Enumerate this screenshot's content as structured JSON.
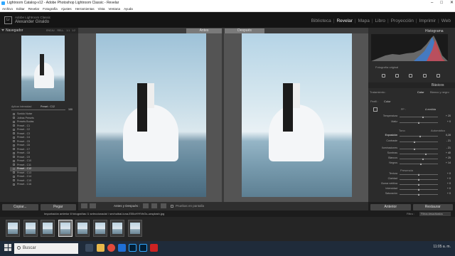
{
  "window": {
    "title": "Lightroom Catalog-v12 - Adobe Photoshop Lightroom Classic - Revelar",
    "controls": [
      "–",
      "□",
      "✕"
    ]
  },
  "menu": [
    "Archivo",
    "Editar",
    "Revelar",
    "Fotografía",
    "Ajustes",
    "Herramientas",
    "Vista",
    "Ventana",
    "Ayuda"
  ],
  "identity": {
    "logo": "Lr",
    "line1": "Adobe Lightroom Classic",
    "line2": "Alexander Giraldo"
  },
  "modules": {
    "items": [
      "Biblioteca",
      "Revelar",
      "Mapa",
      "Libro",
      "Proyección",
      "Imprimir",
      "Web"
    ],
    "active": "Revelar"
  },
  "left_panel": {
    "navigator_title": "Navegador",
    "nav_options": [
      "ENCAJ.",
      "RELL.",
      "1:1",
      "1:2"
    ],
    "amount_label": "Aplicar intensidad",
    "amount_value": "Preset : C12",
    "amount_number": "100",
    "rows": [
      {
        "label": "Sonido Noise",
        "type": "item"
      },
      {
        "label": "Joltras Presets",
        "type": "folder"
      },
      {
        "label": "Presets Bodas",
        "type": "folder"
      },
      {
        "label": "Preset - C1",
        "type": "item"
      },
      {
        "label": "Preset - C2",
        "type": "item"
      },
      {
        "label": "Preset - C3",
        "type": "item"
      },
      {
        "label": "Preset - C4",
        "type": "item"
      },
      {
        "label": "Preset - C5",
        "type": "item"
      },
      {
        "label": "Preset - C6",
        "type": "item"
      },
      {
        "label": "Preset - C7",
        "type": "item"
      },
      {
        "label": "Preset - C8",
        "type": "item"
      },
      {
        "label": "Preset - C9",
        "type": "item"
      },
      {
        "label": "Preset - C10",
        "type": "item"
      },
      {
        "label": "Preset - C11",
        "type": "item"
      },
      {
        "label": "Preset - C12",
        "type": "item",
        "selected": true
      },
      {
        "label": "Preset - C13",
        "type": "item"
      },
      {
        "label": "Preset - C14",
        "type": "item"
      },
      {
        "label": "Preset - C15",
        "type": "item"
      },
      {
        "label": "Preset - C16",
        "type": "item"
      }
    ],
    "copy_button": "Copiar...",
    "paste_button": "Pegar"
  },
  "view": {
    "before_label": "Antes",
    "after_label": "Después",
    "mode_label": "Antes y Después :",
    "proof_label": "Pruebas en pantalla"
  },
  "right_panel": {
    "histogram_label": "Histograma",
    "original_photo_label": "Fotografía original",
    "basic_label": "Básicos",
    "treatment_label": "Tratamiento :",
    "treatment_color": "Color",
    "treatment_bw": "Blanco y negro",
    "profile_label": "Perfil :",
    "profile_value": "Color",
    "wb_label": "PP :",
    "wb_value": "A medida",
    "sliders_top": [
      {
        "label": "Temperatura",
        "value": "+ 20",
        "pos": 0.62
      },
      {
        "label": "Matiz",
        "value": "+ 0",
        "pos": 0.5
      }
    ],
    "tone_title": "Tono",
    "tone_auto": "Automático",
    "sliders_tone": [
      {
        "label": "Exposición",
        "value": "0,28",
        "pos": 0.55,
        "active": true
      },
      {
        "label": "Contraste",
        "value": "- 21",
        "pos": 0.4
      }
    ],
    "sliders_light": [
      {
        "label": "Iluminaciones",
        "value": "- 21",
        "pos": 0.4
      },
      {
        "label": "Sombras",
        "value": "+ 40",
        "pos": 0.7
      },
      {
        "label": "Blancos",
        "value": "+ 25",
        "pos": 0.62
      },
      {
        "label": "Negros",
        "value": "+ 14",
        "pos": 0.57
      }
    ],
    "presence_title": "Presencia",
    "sliders_presence": [
      {
        "label": "Textura",
        "value": "+ 0",
        "pos": 0.5
      },
      {
        "label": "Claridad",
        "value": "+ 0",
        "pos": 0.5
      },
      {
        "label": "Borrar neblina",
        "value": "+ 0",
        "pos": 0.5
      },
      {
        "label": "Intensidad",
        "value": "+ 0",
        "pos": 0.5
      },
      {
        "label": "Saturación",
        "value": "+ 0",
        "pos": 0.5
      }
    ],
    "previous_button": "Anterior",
    "reset_button": "Restaurar"
  },
  "filmstrip": {
    "info": "Importación anterior   8 fotografías /1 seleccionada/ / sechuibal-luna-E55oHYfVbGs-unsplash.jpg",
    "filter_label": "Filtro :",
    "filter_value": "Filtros desactivados",
    "thumb_count": 8,
    "selected_index": 3
  },
  "taskbar": {
    "search_placeholder": "Buscar",
    "clock": "11:05 a. m."
  },
  "colors": {
    "bg": "#1e1e1e",
    "panel": "#2b2b2b",
    "accent_ps": "#31a8ff",
    "selected_row": "#4d4d4d"
  }
}
